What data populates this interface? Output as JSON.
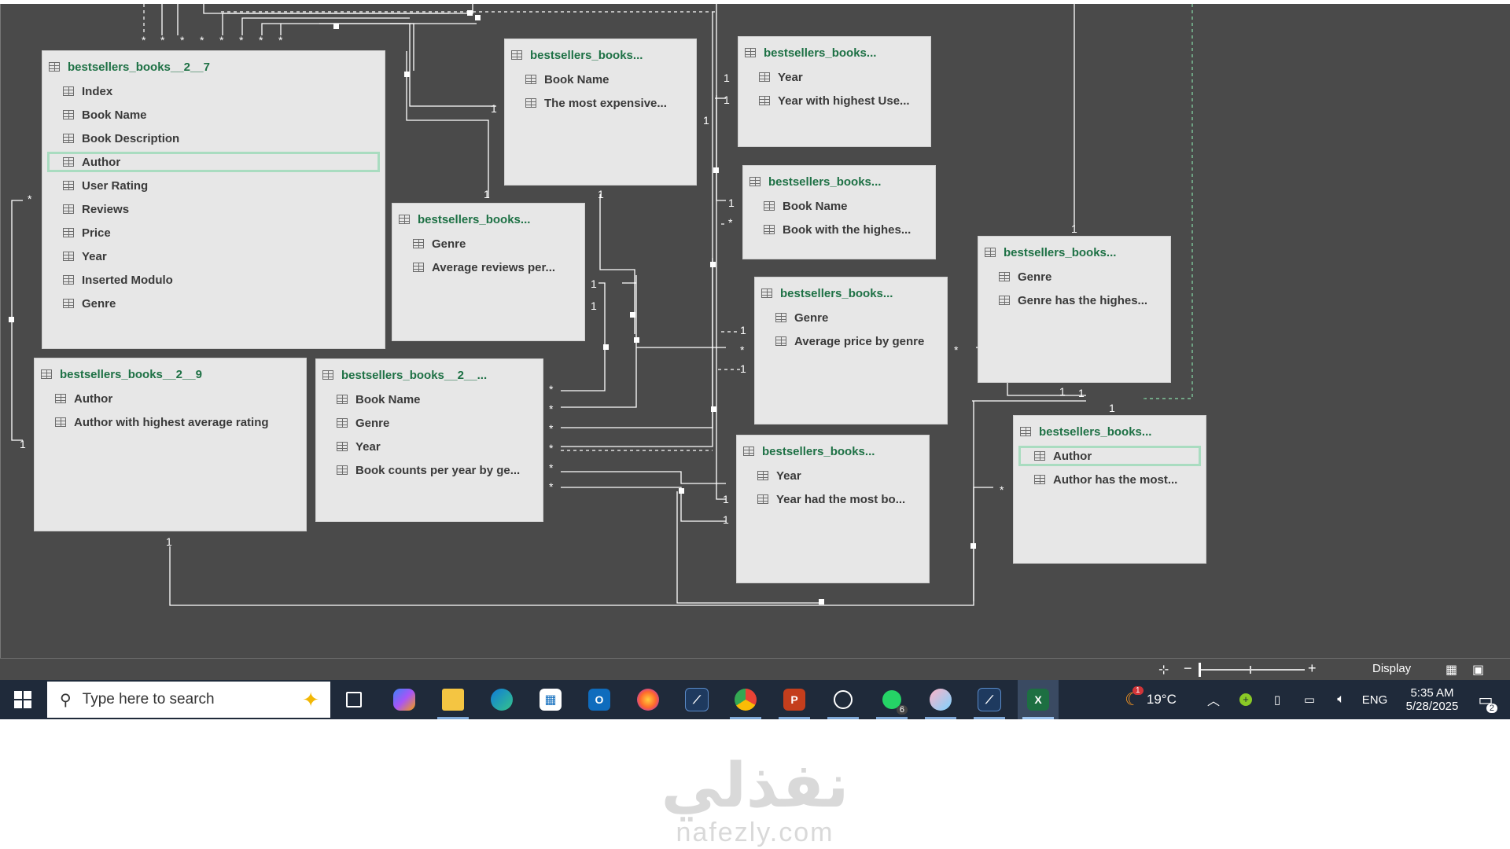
{
  "diagram": {
    "tables": [
      {
        "id": "t1",
        "title": "bestsellers_books__2__7",
        "fields": [
          "Index",
          "Book Name",
          "Book Description",
          "Author",
          "User Rating",
          "Reviews",
          "Price",
          "Year",
          "Inserted Modulo",
          "Genre"
        ],
        "selected_field": "Author"
      },
      {
        "id": "t2",
        "title": "bestsellers_books...",
        "fields": [
          "Book Name",
          "The most expensive..."
        ]
      },
      {
        "id": "t3",
        "title": "bestsellers_books...",
        "fields": [
          "Year",
          "Year with highest Use..."
        ]
      },
      {
        "id": "t4",
        "title": "bestsellers_books...",
        "fields": [
          "Book Name",
          "Book with the highes..."
        ]
      },
      {
        "id": "t5",
        "title": "bestsellers_books...",
        "fields": [
          "Genre",
          "Average reviews per..."
        ]
      },
      {
        "id": "t6",
        "title": "bestsellers_books...",
        "fields": [
          "Genre",
          "Genre has the highes..."
        ]
      },
      {
        "id": "t7",
        "title": "bestsellers_books...",
        "fields": [
          "Genre",
          "Average price by genre"
        ]
      },
      {
        "id": "t8",
        "title": "bestsellers_books__2__9",
        "fields": [
          "Author",
          "Author with highest average rating"
        ]
      },
      {
        "id": "t9",
        "title": "bestsellers_books__2__...",
        "fields": [
          "Book Name",
          "Genre",
          "Year",
          "Book counts per year by ge..."
        ]
      },
      {
        "id": "t10",
        "title": "bestsellers_books...",
        "fields": [
          "Year",
          "Year had the most bo..."
        ]
      },
      {
        "id": "t11",
        "title": "bestsellers_books...",
        "fields": [
          "Author",
          "Author has the most..."
        ],
        "selected_field": "Author"
      }
    ],
    "cardinality_labels": {
      "one": "1",
      "many": "*"
    }
  },
  "statusbar": {
    "display_label": "Display",
    "zoom_minus": "−",
    "zoom_plus": "+"
  },
  "taskbar": {
    "search_placeholder": "Type here to search",
    "weather": "19°C",
    "language": "ENG",
    "time": "5:35 AM",
    "date": "5/28/2025",
    "whatsapp_badge": "6",
    "notifications_badge": "2",
    "weather_badge": "1",
    "apps": [
      "Task View",
      "Copilot",
      "File Explorer",
      "Edge",
      "Microsoft Store",
      "Outlook",
      "Firefox",
      "Power BI",
      "Chrome",
      "PowerPoint",
      "ChatGPT",
      "WhatsApp",
      "Paint",
      "Power BI",
      "Excel"
    ]
  },
  "watermark": {
    "arabic": "نفذلي",
    "latin": "nafezly.com"
  }
}
